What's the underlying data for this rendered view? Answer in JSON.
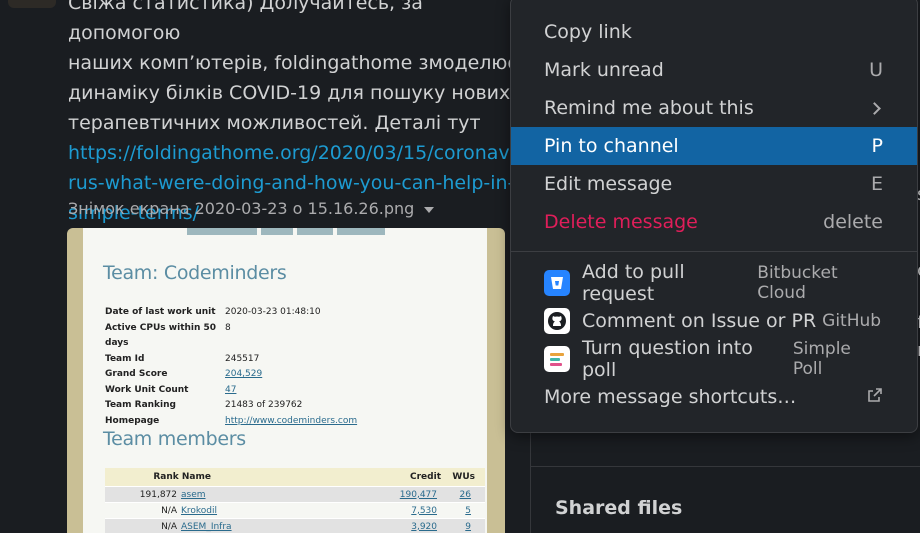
{
  "message": {
    "text_line_partial": "Свіжа статистика) Долучайтесь, за допомогою",
    "text_lines": [
      "наших комп’ютерів, foldingathome змоделює",
      "динаміку білків COVID-19 для пошуку нових",
      "терапевтичних можливостей. Деталі тут"
    ],
    "link_lines": [
      "https://foldingathome.org/2020/03/15/coronavi",
      "rus-what-were-doing-and-how-you-can-help-in-",
      "simple-terms/"
    ],
    "file_name": "Знімок екрана 2020-03-23 о 15.16.26.png"
  },
  "attachment": {
    "team_title": "Team: Codeminders",
    "info": [
      {
        "key": "Date of last work unit",
        "value": "2020-03-23 01:48:10"
      },
      {
        "key": "Active CPUs within 50 days",
        "value": "8"
      },
      {
        "key": "Team Id",
        "value": "245517"
      },
      {
        "key": "Grand Score",
        "value": "204,529"
      },
      {
        "key": "Work Unit Count",
        "value": "47"
      },
      {
        "key": "Team Ranking",
        "value": "21483 of 239762"
      },
      {
        "key": "Homepage",
        "value": "http://www.codeminders.com"
      }
    ],
    "members_title": "Team members",
    "table_headers": {
      "rank_name": "Rank Name",
      "credit": "Credit",
      "wus": "WUs"
    },
    "rows": [
      {
        "rank": "191,872",
        "name": "asem",
        "credit": "190,477",
        "wus": "26"
      },
      {
        "rank": "N/A",
        "name": "Krokodil",
        "credit": "7,530",
        "wus": "5"
      },
      {
        "rank": "N/A",
        "name": "ASEM_Infra",
        "credit": "3,920",
        "wus": "9"
      }
    ]
  },
  "menu": {
    "items": [
      {
        "label": "Copy link",
        "shortcut": ""
      },
      {
        "label": "Mark unread",
        "shortcut": "U"
      },
      {
        "label": "Remind me about this",
        "shortcut": ""
      },
      {
        "label": "Pin to channel",
        "shortcut": "P"
      },
      {
        "label": "Edit message",
        "shortcut": "E"
      },
      {
        "label": "Delete message",
        "shortcut": "delete"
      }
    ],
    "apps": [
      {
        "label": "Add to pull request",
        "app": "Bitbucket Cloud",
        "icon": "bitbucket-icon",
        "color": "#2684ff"
      },
      {
        "label": "Comment on Issue or PR",
        "app": "GitHub",
        "icon": "github-icon",
        "color": "#ffffff"
      },
      {
        "label": "Turn question into poll",
        "app": "Simple Poll",
        "icon": "simple-poll-icon",
        "color": "#ffffff"
      }
    ],
    "more": {
      "label": "More message shortcuts…",
      "icon": "external-link-icon"
    }
  },
  "side_panel": {
    "shared_files": "Shared files",
    "edge_chars": [
      "s",
      "c",
      "f",
      "r"
    ]
  },
  "colors": {
    "active_item": "#1264a3",
    "danger": "#e01e5a",
    "link": "#1d9bd1"
  }
}
